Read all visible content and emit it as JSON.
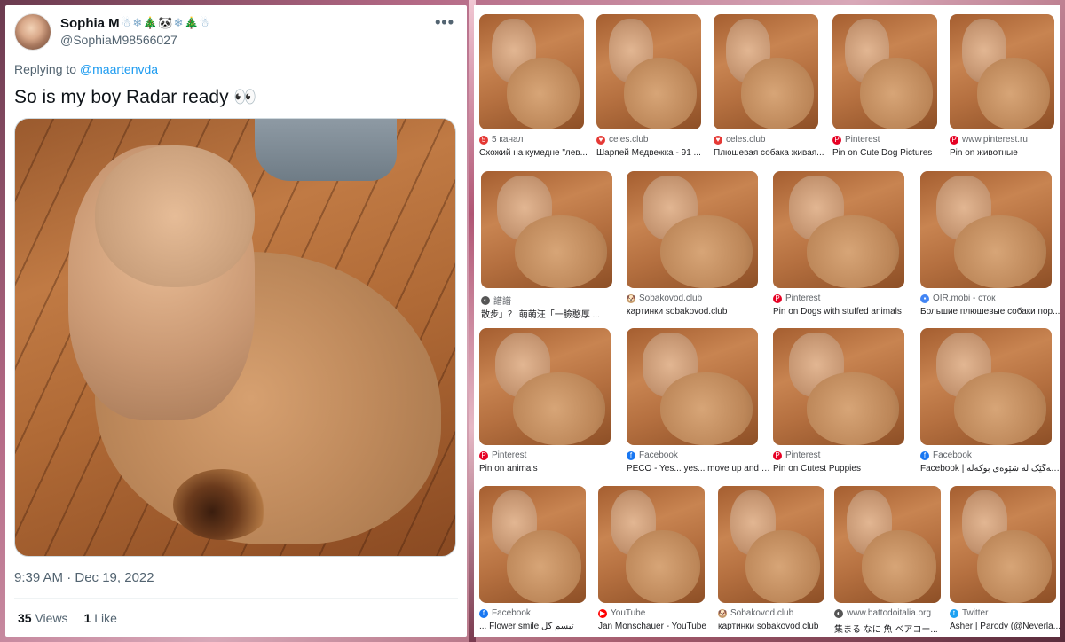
{
  "tweet": {
    "display_name": "Sophia M",
    "name_emoji": "☃❄🎄🐼❄🎄☃",
    "handle": "@SophiaM98566027",
    "replying_prefix": "Replying to ",
    "replying_to": "@maartenvda",
    "text": "So is my boy Radar ready 👀",
    "timestamp": "9:39 AM · Dec 19, 2022",
    "views_count": "35",
    "views_label": "Views",
    "likes_count": "1",
    "likes_label": "Like",
    "more_icon": "•••"
  },
  "colors": {
    "link": "#1d9bf0",
    "pinterest": "#e60023",
    "facebook": "#1877f2",
    "youtube": "#ff0000",
    "twitter": "#1da1f2"
  },
  "results": [
    {
      "source": "5 канал",
      "caption": "Схожий на кумедне \"лев...",
      "icon": "red",
      "glyph": "5"
    },
    {
      "source": "celes.club",
      "caption": "Шарпей Медвежка - 91 ...",
      "icon": "red",
      "glyph": "♥"
    },
    {
      "source": "celes.club",
      "caption": "Плюшевая собака живая...",
      "icon": "red",
      "glyph": "♥"
    },
    {
      "source": "Pinterest",
      "caption": "Pin on Cute Dog Pictures",
      "icon": "pinterest",
      "glyph": "P"
    },
    {
      "source": "www.pinterest.ru",
      "caption": "Pin on животные",
      "icon": "pinterest",
      "glyph": "P"
    },
    {
      "source": "譜譜",
      "caption": "散步」？ 萌萌汪「一臉憨厚 ...",
      "icon": "gray",
      "glyph": "◐"
    },
    {
      "source": "Sobakovod.club",
      "caption": "картинки sobakovod.club",
      "icon": "tan",
      "glyph": "🐶"
    },
    {
      "source": "Pinterest",
      "caption": "Pin on Dogs with stuffed animals",
      "icon": "pinterest",
      "glyph": "P"
    },
    {
      "source": "OIR.mobi - сток",
      "caption": "Большие плюшевые собаки пор...",
      "icon": "multi",
      "glyph": "▪"
    },
    {
      "source": "Pinterest",
      "caption": "Pin on animals",
      "icon": "pinterest",
      "glyph": "P"
    },
    {
      "source": "Facebook",
      "caption": "PECO - Yes... yes... move up and d...",
      "icon": "facebook",
      "glyph": "f"
    },
    {
      "source": "Pinterest",
      "caption": "Pin on Cutest Puppies",
      "icon": "pinterest",
      "glyph": "P"
    },
    {
      "source": "Facebook",
      "caption": "Facebook | سەگێک لە شێوەی بوکەڵە - SNN",
      "icon": "facebook",
      "glyph": "f"
    },
    {
      "source": "Facebook",
      "caption": "... Flower smile تبسم گل",
      "icon": "facebook",
      "glyph": "f"
    },
    {
      "source": "YouTube",
      "caption": "Jan Monschauer - YouTube",
      "icon": "youtube",
      "glyph": "▶"
    },
    {
      "source": "Sobakovod.club",
      "caption": "картинки sobakovod.club",
      "icon": "tan",
      "glyph": "🐶"
    },
    {
      "source": "www.battodoitalia.org",
      "caption": "集まる なに 魚 ベアコー...",
      "icon": "gray",
      "glyph": "◐"
    },
    {
      "source": "Twitter",
      "caption": "Asher | Parody (@Neverla...",
      "icon": "twitter",
      "glyph": "t"
    }
  ]
}
